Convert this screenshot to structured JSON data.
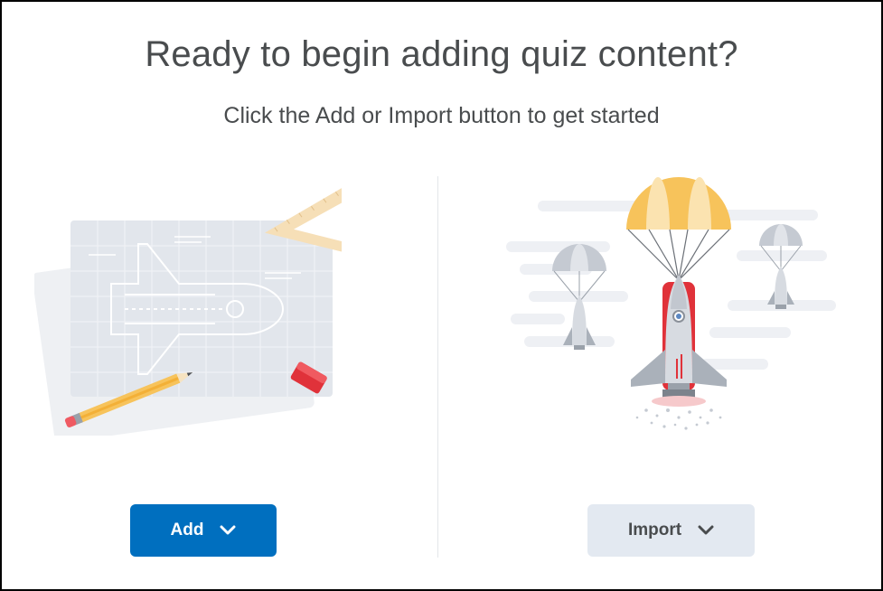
{
  "heading": "Ready to begin adding quiz content?",
  "subheading": "Click the Add or Import button to get started",
  "actions": {
    "add_label": "Add",
    "import_label": "Import"
  },
  "icons": {
    "add_chevron": "chevron-down-icon",
    "import_chevron": "chevron-down-icon",
    "left_illustration": "blueprint-shuttle-illustration",
    "right_illustration": "rocket-parachute-illustration"
  },
  "colors": {
    "primary": "#006fbf",
    "secondary": "#e3e9f1",
    "text": "#494c4e"
  }
}
